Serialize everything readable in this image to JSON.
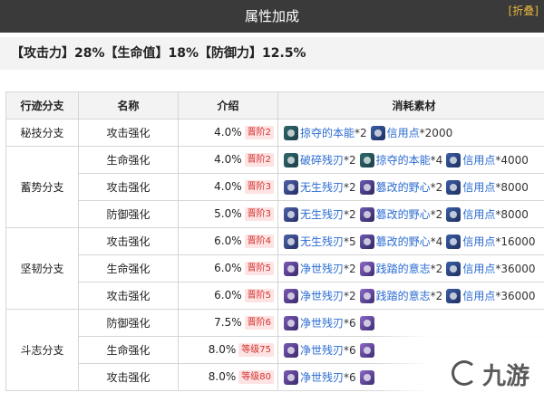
{
  "header": {
    "title": "属性加成",
    "collapse_label": "[折叠]"
  },
  "bonus": {
    "text": "【攻击力】28%【生命值】18%【防御力】12.5%"
  },
  "table": {
    "headers": [
      "行迹分支",
      "名称",
      "介绍",
      "消耗素材"
    ],
    "branches": [
      "秘技分支",
      "蓄势分支",
      "坚韧分支",
      "斗志分支"
    ],
    "rows": [
      {
        "name": "攻击强化",
        "value": "4.0%",
        "tag": "晋阶2",
        "materials": [
          {
            "icon": "wind",
            "name": "掠夺的本能",
            "qty": "*2"
          },
          {
            "icon": "cred",
            "name": "信用点",
            "qty": "*2000"
          }
        ]
      },
      {
        "name": "生命强化",
        "value": "4.0%",
        "tag": "晋阶2",
        "materials": [
          {
            "icon": "wind",
            "name": "破碎残刃",
            "qty": "*2"
          },
          {
            "icon": "wind",
            "name": "掠夺的本能",
            "qty": "*4"
          },
          {
            "icon": "cred",
            "name": "信用点",
            "qty": "*4000"
          }
        ]
      },
      {
        "name": "攻击强化",
        "value": "4.0%",
        "tag": "晋阶3",
        "materials": [
          {
            "icon": "blade",
            "name": "无生残刃",
            "qty": "*2"
          },
          {
            "icon": "ambit",
            "name": "篡改的野心",
            "qty": "*2"
          },
          {
            "icon": "cred",
            "name": "信用点",
            "qty": "*8000"
          }
        ]
      },
      {
        "name": "防御强化",
        "value": "5.0%",
        "tag": "晋阶3",
        "materials": [
          {
            "icon": "blade",
            "name": "无生残刃",
            "qty": "*2"
          },
          {
            "icon": "ambit",
            "name": "篡改的野心",
            "qty": "*2"
          },
          {
            "icon": "cred",
            "name": "信用点",
            "qty": "*8000"
          }
        ]
      },
      {
        "name": "攻击强化",
        "value": "6.0%",
        "tag": "晋阶4",
        "materials": [
          {
            "icon": "blade",
            "name": "无生残刃",
            "qty": "*5"
          },
          {
            "icon": "ambit",
            "name": "篡改的野心",
            "qty": "*4"
          },
          {
            "icon": "cred",
            "name": "信用点",
            "qty": "*16000"
          }
        ]
      },
      {
        "name": "生命强化",
        "value": "6.0%",
        "tag": "晋阶5",
        "materials": [
          {
            "icon": "pure",
            "name": "净世残刃",
            "qty": "*2"
          },
          {
            "icon": "will",
            "name": "践踏的意志",
            "qty": "*2"
          },
          {
            "icon": "cred",
            "name": "信用点",
            "qty": "*36000"
          }
        ]
      },
      {
        "name": "攻击强化",
        "value": "6.0%",
        "tag": "晋阶5",
        "materials": [
          {
            "icon": "pure",
            "name": "净世残刃",
            "qty": "*2"
          },
          {
            "icon": "will",
            "name": "践踏的意志",
            "qty": "*2"
          },
          {
            "icon": "cred",
            "name": "信用点",
            "qty": "*36000"
          }
        ]
      },
      {
        "name": "防御强化",
        "value": "7.5%",
        "tag": "晋阶6",
        "materials": [
          {
            "icon": "pure",
            "name": "净世残刃",
            "qty": "*6"
          },
          {
            "icon": "will",
            "name": "",
            "qty": ""
          }
        ]
      },
      {
        "name": "生命强化",
        "value": "8.0%",
        "tag": "等级75",
        "materials": [
          {
            "icon": "pure",
            "name": "净世残刃",
            "qty": "*6"
          },
          {
            "icon": "will",
            "name": "",
            "qty": ""
          }
        ]
      },
      {
        "name": "攻击强化",
        "value": "8.0%",
        "tag": "等级80",
        "materials": [
          {
            "icon": "pure",
            "name": "净世残刃",
            "qty": "*6"
          },
          {
            "icon": "will",
            "name": "",
            "qty": ""
          }
        ]
      }
    ]
  },
  "watermark": {
    "text": "九游"
  },
  "colors": {
    "title_bg": "#3a3a3a",
    "collapse": "#e7b53e",
    "tag_text": "#d4322f",
    "link": "#2a6bd1"
  }
}
